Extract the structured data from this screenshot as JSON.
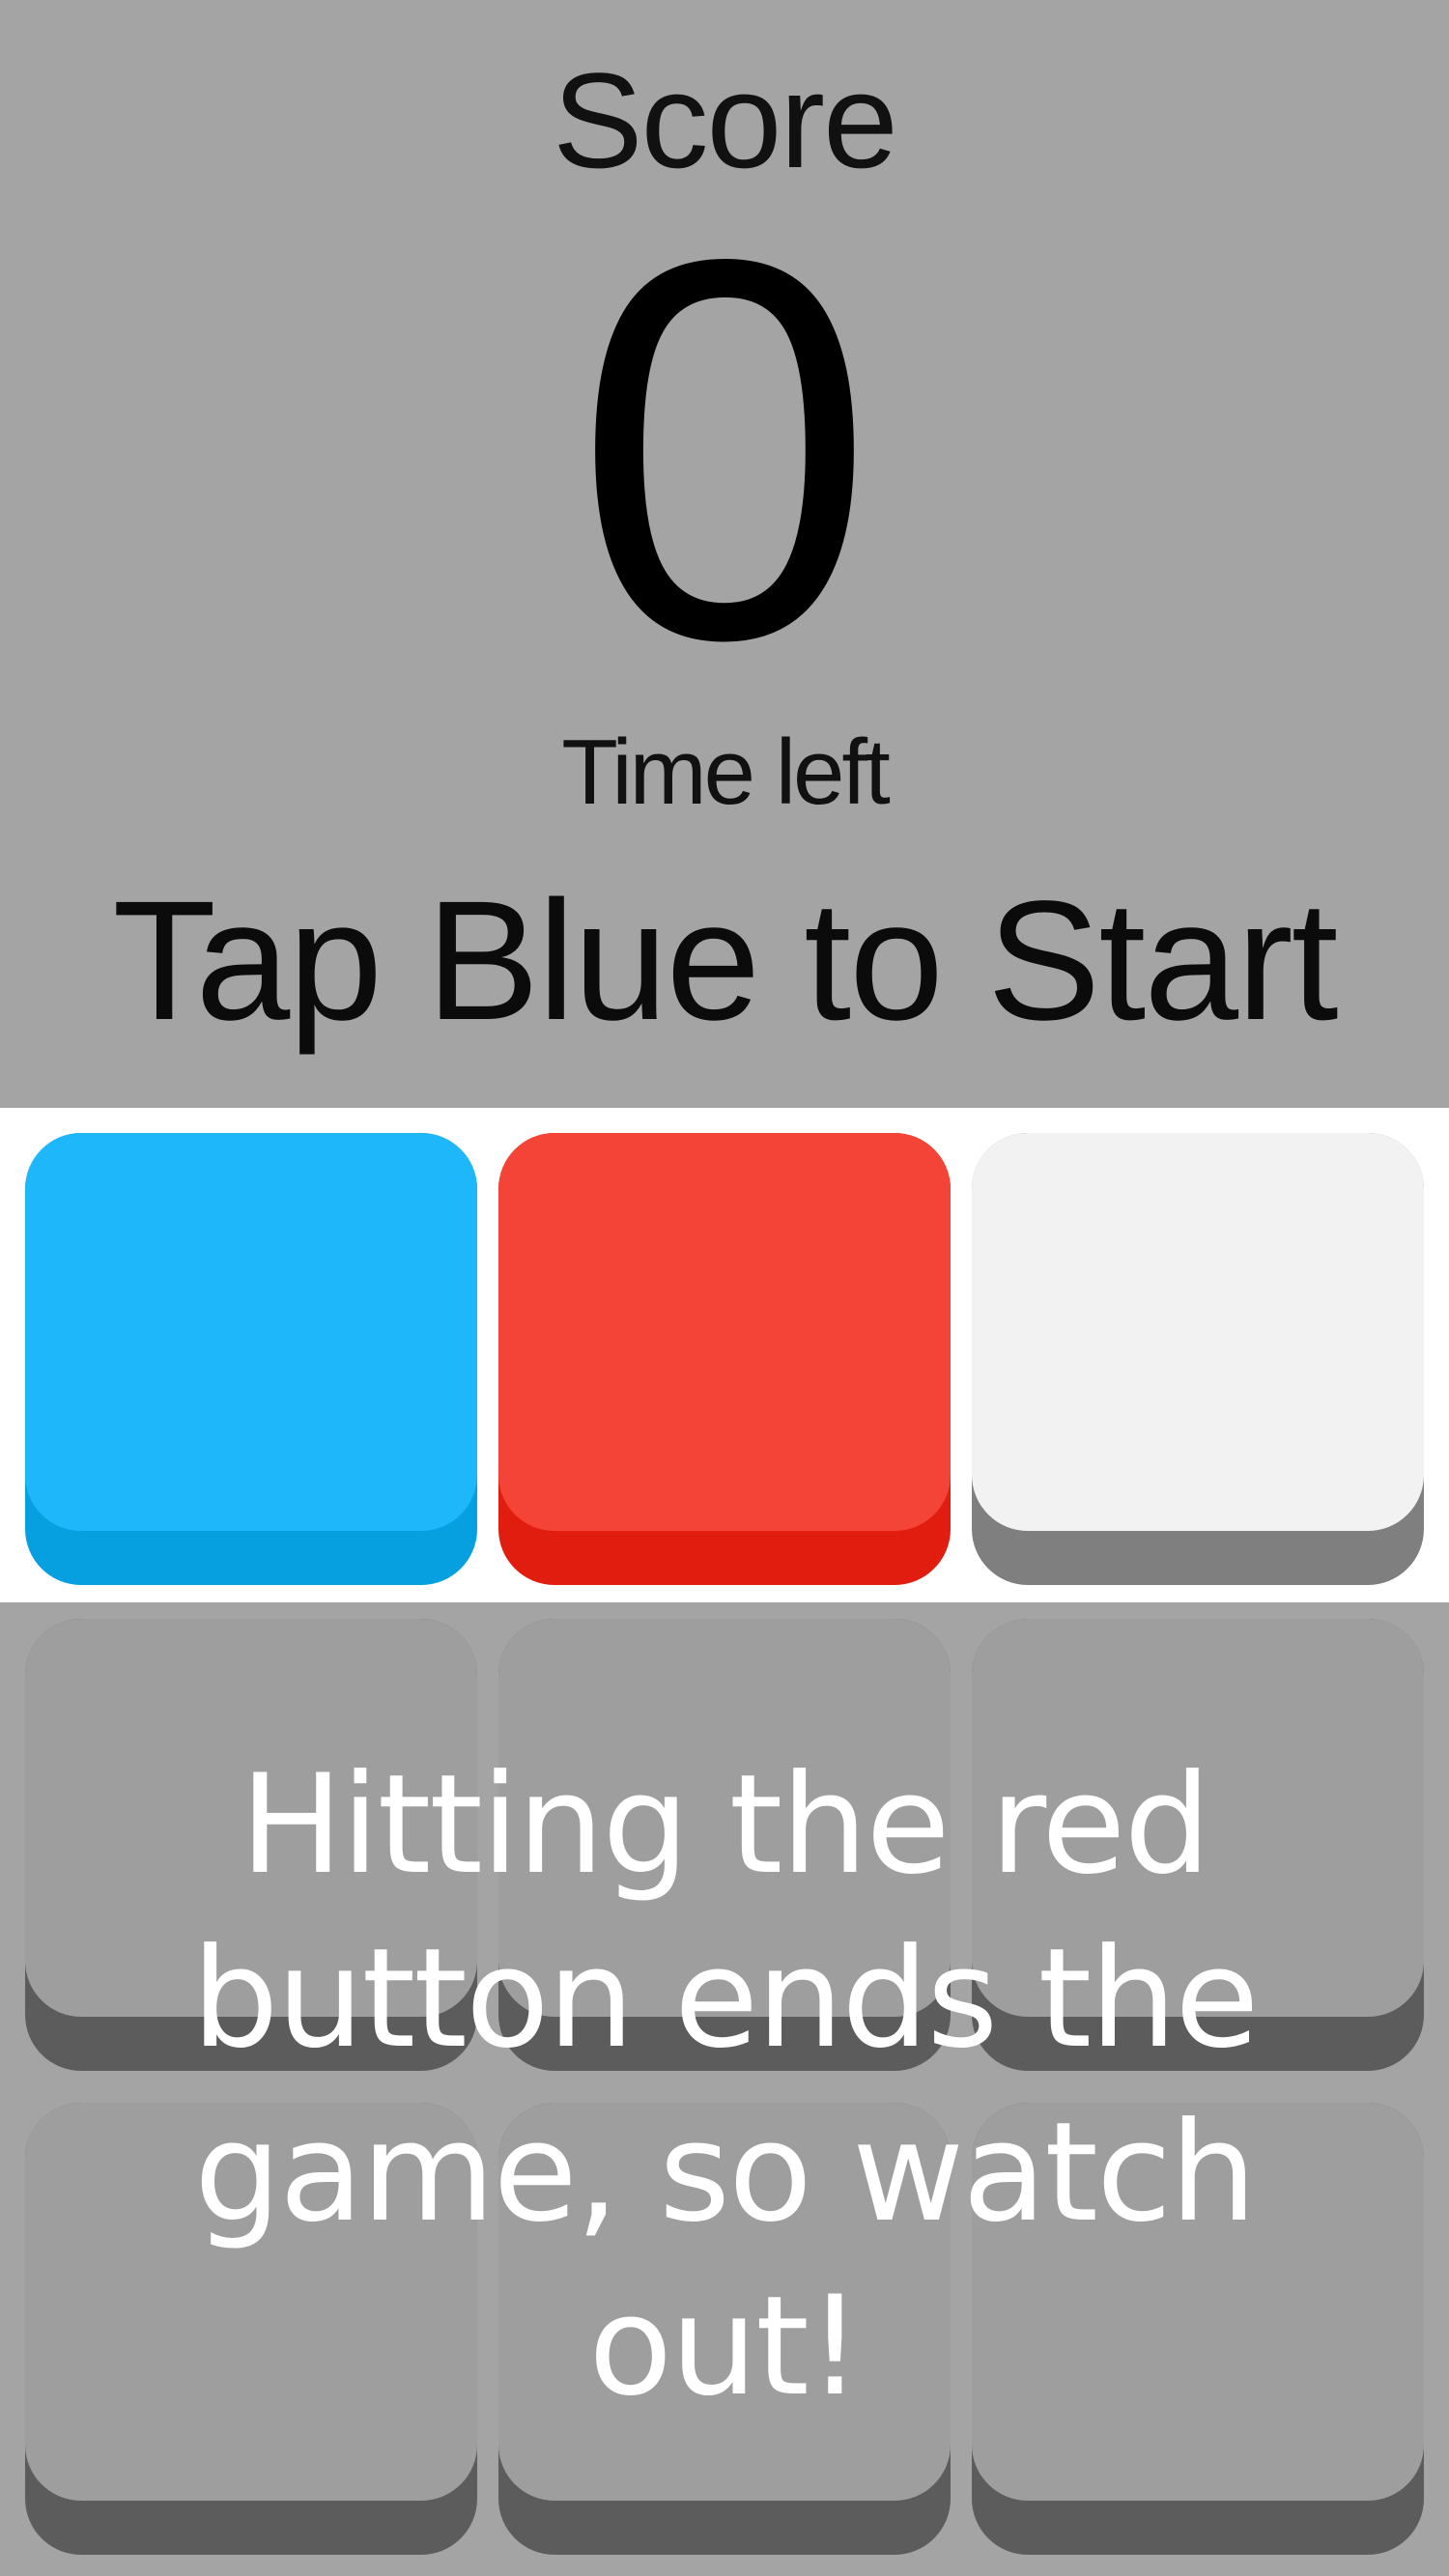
{
  "header": {
    "score_label": "Score",
    "score_value": "0",
    "time_label": "Time left",
    "status": "Tap Blue to Start"
  },
  "board": {
    "active_row": [
      {
        "name": "blue-tile",
        "color": "#1db7fa"
      },
      {
        "name": "red-tile",
        "color": "#f44337"
      },
      {
        "name": "white-tile",
        "color": "#f2f2f2"
      }
    ],
    "inactive_color": "#9e9e9e"
  },
  "hint": {
    "text": "Hitting the red button ends the game, so watch out!"
  },
  "colors": {
    "background": "#a4a4a4",
    "blue": "#1db7fa",
    "red": "#f44337",
    "white": "#f2f2f2"
  }
}
